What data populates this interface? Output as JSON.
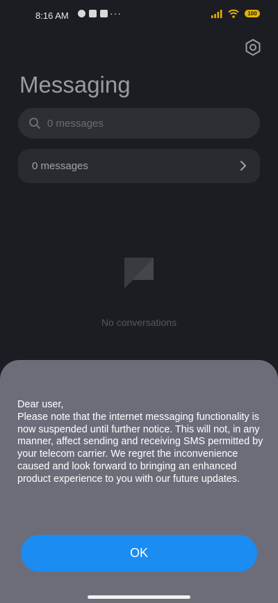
{
  "status_bar": {
    "time": "8:16 AM",
    "dots": "···",
    "battery": "100"
  },
  "header": {
    "title": "Messaging",
    "settings_icon": "gear-icon"
  },
  "search": {
    "placeholder": "0 messages",
    "icon": "search-icon"
  },
  "message_row": {
    "label": "0 messages"
  },
  "empty_state": {
    "text": "No conversations"
  },
  "dialog": {
    "greeting": "Dear user,",
    "body": "Please note that the internet messaging functionality is now suspended until further notice. This will not, in any manner, affect sending and receiving SMS permitted by your telecom carrier. We regret the inconvenience caused and look forward to bringing an enhanced product experience to you with our future updates.",
    "ok_label": "OK",
    "accent_color": "#1a8cf2"
  }
}
